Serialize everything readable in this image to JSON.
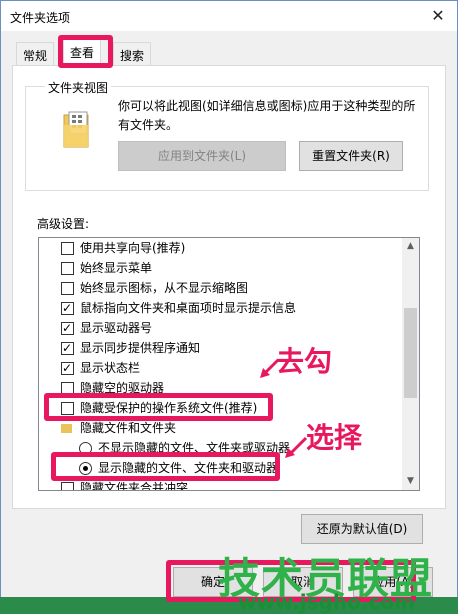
{
  "window": {
    "title": "文件夹选项",
    "close_glyph": "✕"
  },
  "tabs": [
    {
      "label": "常规",
      "active": false
    },
    {
      "label": "查看",
      "active": true
    },
    {
      "label": "搜索",
      "active": false
    }
  ],
  "folder_views": {
    "legend": "文件夹视图",
    "description": "你可以将此视图(如详细信息或图标)应用于这种类型的所有文件夹。",
    "apply_button": "应用到文件夹(L)",
    "reset_button": "重置文件夹(R)"
  },
  "advanced": {
    "label": "高级设置:",
    "items": [
      {
        "type": "checkbox",
        "checked": false,
        "label": "使用共享向导(推荐)"
      },
      {
        "type": "checkbox",
        "checked": false,
        "label": "始终显示菜单"
      },
      {
        "type": "checkbox",
        "checked": false,
        "label": "始终显示图标，从不显示缩略图"
      },
      {
        "type": "checkbox",
        "checked": true,
        "label": "鼠标指向文件夹和桌面项时显示提示信息"
      },
      {
        "type": "checkbox",
        "checked": true,
        "label": "显示驱动器号"
      },
      {
        "type": "checkbox",
        "checked": true,
        "label": "显示同步提供程序通知"
      },
      {
        "type": "checkbox",
        "checked": true,
        "label": "显示状态栏"
      },
      {
        "type": "checkbox",
        "checked": false,
        "label": "隐藏空的驱动器"
      },
      {
        "type": "checkbox",
        "checked": false,
        "label": "隐藏受保护的操作系统文件(推荐)"
      },
      {
        "type": "folder",
        "label": "隐藏文件和文件夹"
      },
      {
        "type": "radio",
        "checked": false,
        "label": "不显示隐藏的文件、文件夹或驱动器"
      },
      {
        "type": "radio",
        "checked": true,
        "label": "显示隐藏的文件、文件夹和驱动器"
      },
      {
        "type": "checkbox",
        "checked": false,
        "label": "隐藏文件夹合并冲突"
      }
    ],
    "restore_button": "还原为默认值(D)"
  },
  "footer": {
    "ok_button": "确定",
    "cancel_button": "取消",
    "apply_button": "应用(A)"
  },
  "annotations": {
    "uncheck": "去勾",
    "select": "选择"
  },
  "watermark": {
    "text": "技术员联盟",
    "url": "www.jsgho.com"
  },
  "colors": {
    "highlight": "#e8185f",
    "watermark": "#2fb24a"
  }
}
